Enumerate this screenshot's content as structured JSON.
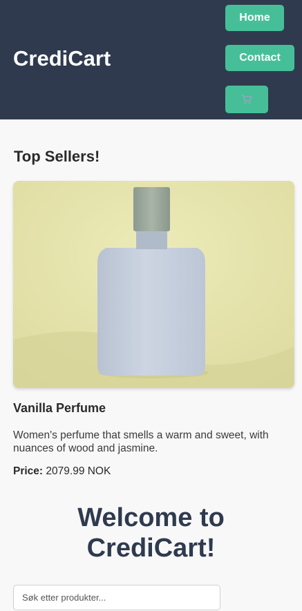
{
  "header": {
    "logo": "CrediCart",
    "nav": {
      "home_label": "Home",
      "contact_label": "Contact",
      "cart_icon": "cart-icon"
    }
  },
  "top_sellers": {
    "title": "Top Sellers!",
    "product": {
      "name": "Vanilla Perfume",
      "description": "Women's perfume that smells a warm and sweet, with nuances of wood and jasmine.",
      "price_label": "Price:",
      "price_value": "2079.99 NOK"
    }
  },
  "welcome": {
    "line1": "Welcome to",
    "line2": "CrediCart!"
  },
  "search": {
    "placeholder": "Søk etter produkter..."
  },
  "colors": {
    "header_bg": "#2f3a4f",
    "accent": "#46bf98",
    "page_bg": "#f8f8f8"
  }
}
